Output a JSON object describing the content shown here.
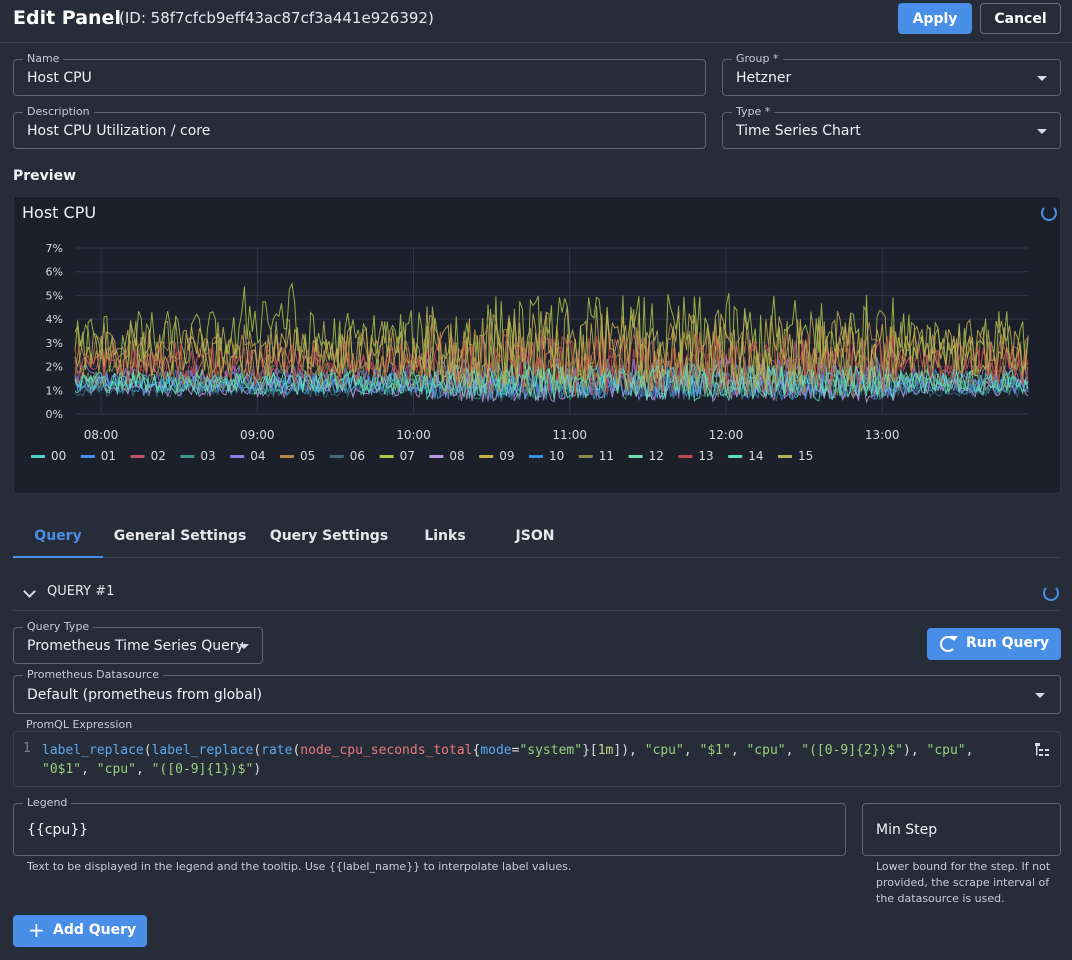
{
  "header": {
    "title": "Edit Panel",
    "panel_id": "(ID: 58f7cfcb9eff43ac87cf3a441e926392)",
    "apply_label": "Apply",
    "cancel_label": "Cancel"
  },
  "form": {
    "name": {
      "label": "Name",
      "value": "Host CPU"
    },
    "group": {
      "label": "Group *",
      "value": "Hetzner"
    },
    "description": {
      "label": "Description",
      "value": "Host CPU Utilization / core"
    },
    "type": {
      "label": "Type *",
      "value": "Time Series Chart"
    }
  },
  "preview": {
    "section_label": "Preview",
    "panel_title": "Host CPU"
  },
  "tabs": [
    "Query",
    "General Settings",
    "Query Settings",
    "Links",
    "JSON"
  ],
  "query": {
    "title": "QUERY #1",
    "query_type": {
      "label": "Query Type",
      "value": "Prometheus Time Series Query"
    },
    "run_label": "Run Query",
    "datasource": {
      "label": "Prometheus Datasource",
      "value": "Default (prometheus from global)"
    },
    "promql": {
      "label": "PromQL Expression",
      "line_number": "1",
      "expression": "label_replace(label_replace(rate(node_cpu_seconds_total{mode=\"system\"}[1m]), \"cpu\", \"$1\", \"cpu\", \"([0-9]{2})$\"), \"cpu\", \"0$1\", \"cpu\", \"([0-9]{1})$\")"
    },
    "legend": {
      "label": "Legend",
      "value": "{{cpu}}",
      "helper": "Text to be displayed in the legend and the tooltip. Use {{label_name}} to interpolate label values."
    },
    "min_step": {
      "placeholder": "Min Step",
      "helper": "Lower bound for the step. If not provided, the scrape interval of the datasource is used."
    }
  },
  "add_query_label": "Add Query",
  "chart_data": {
    "type": "line",
    "title": "Host CPU",
    "x_ticks": [
      "08:00",
      "09:00",
      "10:00",
      "11:00",
      "12:00",
      "13:00"
    ],
    "x_range": [
      "07:50",
      "13:56"
    ],
    "y_ticks": [
      "0%",
      "1%",
      "2%",
      "3%",
      "4%",
      "5%",
      "6%",
      "7%"
    ],
    "ylim": [
      0,
      7
    ],
    "grid": true,
    "legend_position": "bottom",
    "series": [
      {
        "name": "00",
        "color": "#4fd1c5",
        "base": 1.3,
        "amp": 0.4
      },
      {
        "name": "01",
        "color": "#4a8fe7",
        "base": 1.4,
        "amp": 0.5
      },
      {
        "name": "02",
        "color": "#c0506a",
        "base": 2.2,
        "amp": 0.7
      },
      {
        "name": "03",
        "color": "#3a9a8a",
        "base": 1.2,
        "amp": 0.4
      },
      {
        "name": "04",
        "color": "#8a7ee8",
        "base": 1.5,
        "amp": 0.6
      },
      {
        "name": "05",
        "color": "#b8824a",
        "base": 2.4,
        "amp": 1.0
      },
      {
        "name": "06",
        "color": "#3d6a80",
        "base": 1.0,
        "amp": 0.3
      },
      {
        "name": "07",
        "color": "#a8c84a",
        "base": 3.0,
        "amp": 1.4
      },
      {
        "name": "08",
        "color": "#b89ae0",
        "base": 1.1,
        "amp": 0.4
      },
      {
        "name": "09",
        "color": "#c8b04a",
        "base": 2.6,
        "amp": 1.1
      },
      {
        "name": "10",
        "color": "#3a90d8",
        "base": 1.2,
        "amp": 0.4
      },
      {
        "name": "11",
        "color": "#8a8a4a",
        "base": 1.6,
        "amp": 0.6
      },
      {
        "name": "12",
        "color": "#6ae0b0",
        "base": 1.4,
        "amp": 0.5
      },
      {
        "name": "13",
        "color": "#c04a4a",
        "base": 2.1,
        "amp": 0.9
      },
      {
        "name": "14",
        "color": "#5ae0c0",
        "base": 1.3,
        "amp": 0.5
      },
      {
        "name": "15",
        "color": "#b8b05a",
        "base": 2.8,
        "amp": 1.2
      }
    ]
  }
}
